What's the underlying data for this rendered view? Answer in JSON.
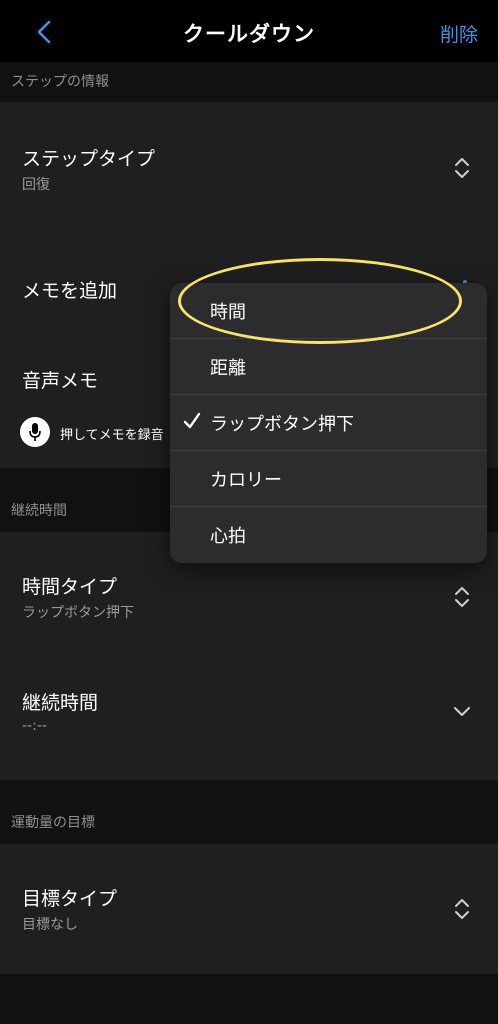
{
  "nav": {
    "back_icon": "chevron-left-icon",
    "title": "クールダウン",
    "action": "削除"
  },
  "sections": {
    "step_info": "ステップの情報",
    "duration": "継続時間",
    "target": "運動量の目標"
  },
  "step_type": {
    "title": "ステップタイプ",
    "value": "回復",
    "icon": "updown-chevron-icon"
  },
  "memo": {
    "title": "メモを追加"
  },
  "voice_memo": {
    "title": "音声メモ",
    "record_label": "押してメモを録音",
    "icon": "microphone-icon"
  },
  "time_type": {
    "title": "時間タイプ",
    "value": "ラップボタン押下",
    "icon": "updown-chevron-icon"
  },
  "duration_row": {
    "title": "継続時間",
    "value": "--:--",
    "icon": "chevron-down-icon"
  },
  "target_type": {
    "title": "目標タイプ",
    "value": "目標なし",
    "icon": "updown-chevron-icon"
  },
  "menu": {
    "items": [
      {
        "label": "時間",
        "checked": false
      },
      {
        "label": "距離",
        "checked": false
      },
      {
        "label": "ラップボタン押下",
        "checked": true
      },
      {
        "label": "カロリー",
        "checked": false
      },
      {
        "label": "心拍",
        "checked": false
      }
    ]
  },
  "colors": {
    "accent": "#4a90e2",
    "highlight": "#f5e36b",
    "background": "#000000",
    "group": "#1f1f1f",
    "menu": "#2c2c2e"
  }
}
